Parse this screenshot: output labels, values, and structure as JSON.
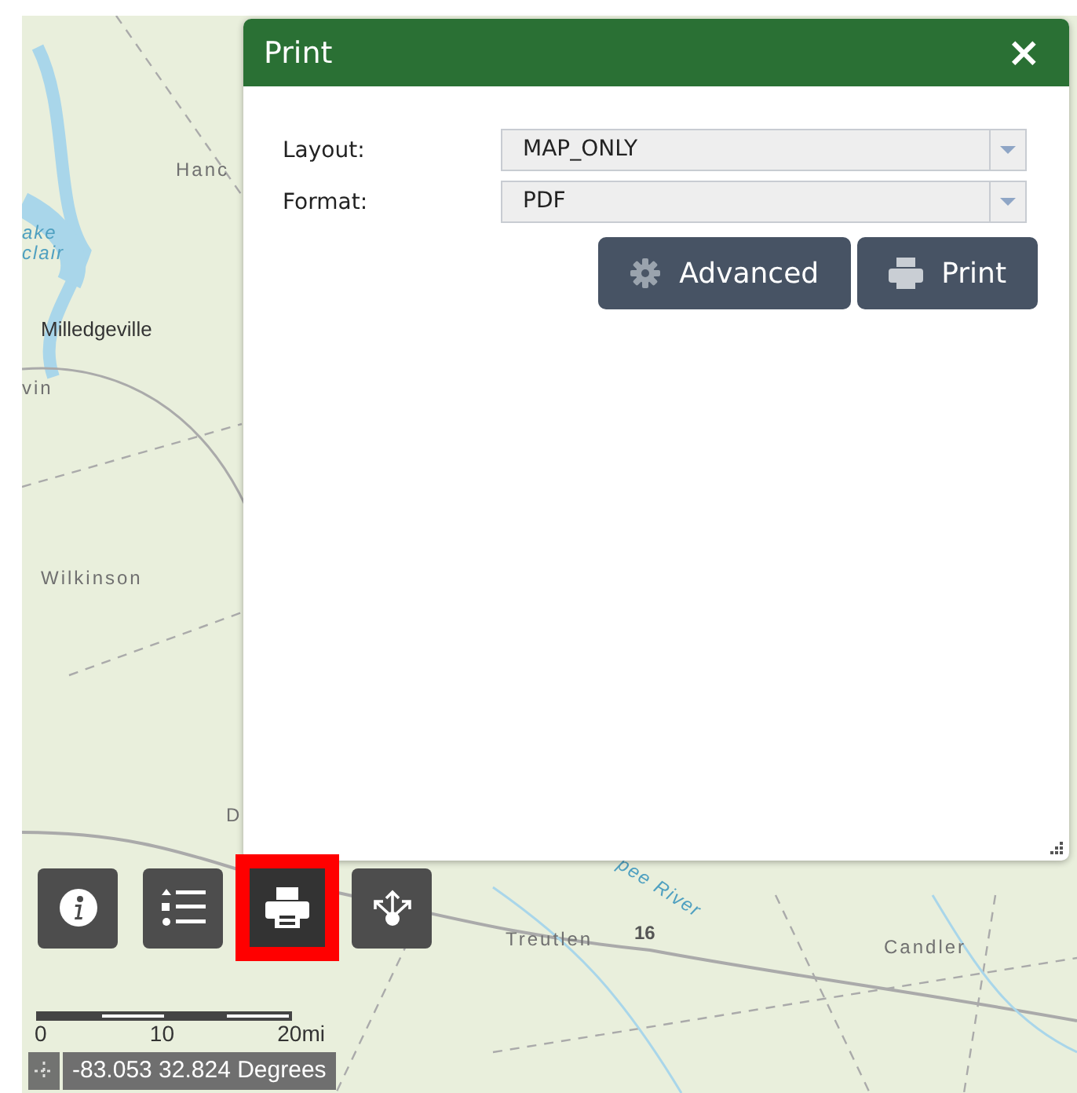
{
  "map": {
    "labels": [
      {
        "text": "Hanc",
        "kind": "place"
      },
      {
        "text": "ake",
        "kind": "water"
      },
      {
        "text": "clair",
        "kind": "water"
      },
      {
        "text": "Milledgeville",
        "kind": "city"
      },
      {
        "text": "vin",
        "kind": "place"
      },
      {
        "text": "Wilkinson",
        "kind": "place"
      },
      {
        "text": "D",
        "kind": "place"
      },
      {
        "text": "pee River",
        "kind": "water"
      },
      {
        "text": "Treutlen",
        "kind": "place"
      },
      {
        "text": "16",
        "kind": "road"
      },
      {
        "text": "Candler",
        "kind": "place"
      }
    ]
  },
  "print_dialog": {
    "title": "Print",
    "close": "×",
    "fields": [
      {
        "label": "Layout:",
        "value": "MAP_ONLY"
      },
      {
        "label": "Format:",
        "value": "PDF"
      }
    ],
    "buttons": [
      {
        "label": "Advanced",
        "kind": "advanced"
      },
      {
        "label": "Print",
        "kind": "print"
      }
    ]
  },
  "toolbar": [
    {
      "kind": "info",
      "selected": false
    },
    {
      "kind": "legend",
      "selected": false
    },
    {
      "kind": "print",
      "selected": true
    },
    {
      "kind": "share",
      "selected": false
    }
  ],
  "scale_bar": {
    "ticks": [
      "0",
      "10",
      "20mi"
    ]
  },
  "coordinates": "-83.053 32.824 Degrees"
}
